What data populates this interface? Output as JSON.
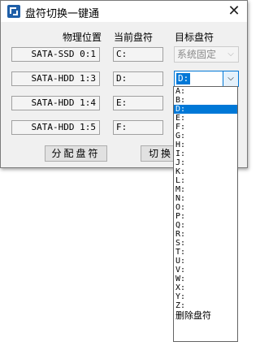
{
  "window": {
    "title": "盘符切换一键通",
    "close_glyph": "✕"
  },
  "headers": {
    "physical": "物理位置",
    "current": "当前盘符",
    "target": "目标盘符"
  },
  "rows": [
    {
      "device": "SATA-SSD 0:1",
      "current": "C:",
      "target": "系统固定"
    },
    {
      "device": "SATA-HDD 1:3",
      "current": "D:",
      "target": "D:"
    },
    {
      "device": "SATA-HDD 1:4",
      "current": "E:",
      "target": ""
    },
    {
      "device": "SATA-HDD 1:5",
      "current": "F:",
      "target": ""
    }
  ],
  "buttons": {
    "assign": "分配盘符",
    "switch": "切换"
  },
  "dropdown": {
    "selected": "D:",
    "options": [
      "A:",
      "B:",
      "D:",
      "E:",
      "F:",
      "G:",
      "H:",
      "I:",
      "J:",
      "K:",
      "L:",
      "M:",
      "N:",
      "O:",
      "P:",
      "Q:",
      "R:",
      "S:",
      "T:",
      "U:",
      "V:",
      "W:",
      "X:",
      "Y:",
      "Z:",
      "删除盘符"
    ]
  },
  "icons": {
    "app": "app-logo-icon",
    "close": "close-icon",
    "chevron": "chevron-down-icon"
  },
  "colors": {
    "accent": "#0078d7",
    "window_bg": "#f0f0f0"
  }
}
